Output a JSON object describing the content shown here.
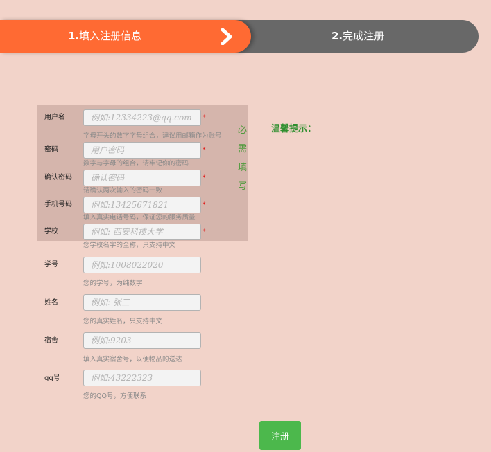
{
  "steps": [
    {
      "num": "1.",
      "label": "填入注册信息"
    },
    {
      "num": "2.",
      "label": "完成注册"
    }
  ],
  "fields": [
    {
      "label": "用户名",
      "placeholder": "例如:12334223@qq.com",
      "required_mark": "*",
      "hint": "字母开头的数字字母组合，建议用邮箱作为账号"
    },
    {
      "label": "密码",
      "placeholder": "用户密码",
      "required_mark": "*",
      "hint": "数字与字母的组合，请牢记你的密码"
    },
    {
      "label": "确认密码",
      "placeholder": "确认密码",
      "required_mark": "*",
      "hint": "请确认两次输入的密码一致"
    },
    {
      "label": "手机号码",
      "placeholder": "例如:13425671821",
      "required_mark": "*",
      "hint": "填入真实电话号码，保证您的服务质量"
    },
    {
      "label": "学校",
      "placeholder": "例如: 西安科技大学",
      "required_mark": "*",
      "hint": "您学校名字的全称，只支持中文"
    },
    {
      "label": "学号",
      "placeholder": "例如:1008022020",
      "hint": "您的学号，为纯数字"
    },
    {
      "label": "姓名",
      "placeholder": "例如: 张三",
      "hint": "您的真实姓名，只支持中文"
    },
    {
      "label": "宿舍",
      "placeholder": "例如:9203",
      "hint": "填入真实宿舍号，以便物品的送达"
    },
    {
      "label": "qq号",
      "placeholder": "例如:43222323",
      "hint": "您的QQ号，方便联系"
    }
  ],
  "required_note": "必需填写",
  "tip_title": "温馨提示：",
  "submit_label": "注册",
  "colors": {
    "background": "#f2d3c9",
    "step_active": "#ff6a33",
    "step_inactive": "#686868",
    "required_block": "#d5b5ac",
    "accent_green": "#4cb84c",
    "required_star": "#e01010"
  },
  "icons": {
    "step_arrow": "chevron-right-icon"
  }
}
